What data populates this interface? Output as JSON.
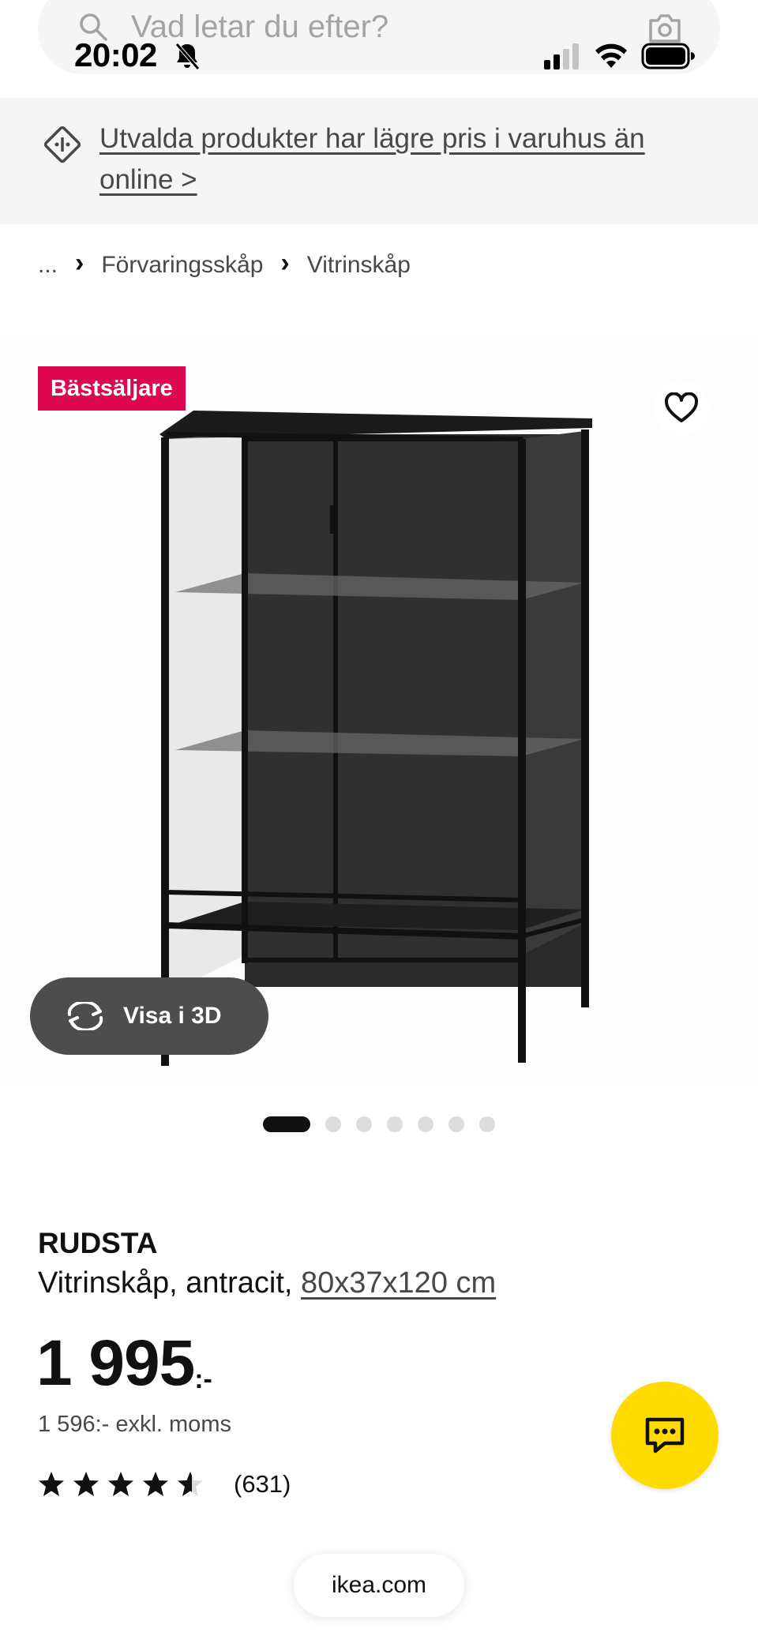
{
  "search": {
    "placeholder": "Vad letar du efter?"
  },
  "status_bar": {
    "time": "20:02"
  },
  "banner": {
    "text": "Utvalda produkter har lägre pris i varuhus än online >"
  },
  "breadcrumb": {
    "ellipsis": "...",
    "items": [
      "Förvaringsskåp",
      "Vitrinskåp"
    ]
  },
  "product_image": {
    "badge": "Bästsäljare",
    "view_3d_label": "Visa i 3D",
    "carousel": {
      "total": 7,
      "active_index": 0
    }
  },
  "product": {
    "name": "RUDSTA",
    "description": "Vitrinskåp, antracit, ",
    "size": "80x37x120 cm",
    "price": "1 995",
    "price_suffix": ":-",
    "price_ex_vat": "1 596:- exkl. moms",
    "rating": {
      "stars": 4.5,
      "max": 5,
      "count": "(631)"
    }
  },
  "browser": {
    "url": "ikea.com"
  },
  "colors": {
    "badge": "#e00751",
    "chat_button": "#ffdb00",
    "view3d_button": "#4d4d4d",
    "banner_bg": "#f5f5f5"
  }
}
